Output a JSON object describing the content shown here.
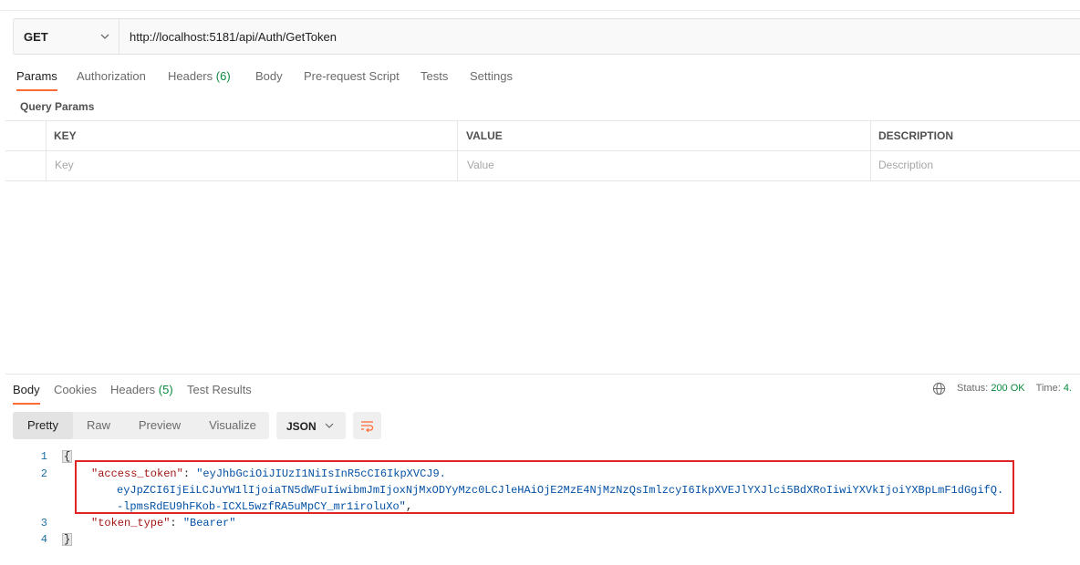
{
  "request": {
    "method": "GET",
    "url": "http://localhost:5181/api/Auth/GetToken"
  },
  "request_tabs": [
    {
      "label": "Params",
      "active": true
    },
    {
      "label": "Authorization"
    },
    {
      "label": "Headers",
      "count": "(6)"
    },
    {
      "label": "Body"
    },
    {
      "label": "Pre-request Script"
    },
    {
      "label": "Tests"
    },
    {
      "label": "Settings"
    }
  ],
  "query_params": {
    "title": "Query Params",
    "columns": [
      "KEY",
      "VALUE",
      "DESCRIPTION"
    ],
    "placeholders": [
      "Key",
      "Value",
      "Description"
    ]
  },
  "response_tabs": [
    {
      "label": "Body",
      "active": true
    },
    {
      "label": "Cookies"
    },
    {
      "label": "Headers",
      "count": "(5)"
    },
    {
      "label": "Test Results"
    }
  ],
  "response_status": {
    "status_label": "Status:",
    "status_value": "200 OK",
    "time_label": "Time:",
    "time_value": "4."
  },
  "view_modes": [
    "Pretty",
    "Raw",
    "Preview",
    "Visualize"
  ],
  "format": "JSON",
  "code": {
    "line_numbers": [
      "1",
      "2",
      "3",
      "4"
    ],
    "open_brace": "{",
    "close_brace": "}",
    "access_token_key": "\"access_token\"",
    "access_token_value_1": "\"eyJhbGciOiJIUzI1NiIsInR5cCI6IkpXVCJ9.",
    "access_token_value_2": "eyJpZCI6IjEiLCJuYW1lIjoiaTN5dWFuIiwibmJmIjoxNjMxODYyMzc0LCJleHAiOjE2MzE4NjMzNzQsImlzcyI6IkpXVEJlYXJlci5BdXRoIiwiYXVkIjoiYXBpLmF1dGgifQ.",
    "access_token_value_3": "-lpmsRdEU9hFKob-ICXL5wzfRA5uMpCY_mr1iroluXo\"",
    "token_type_key": "\"token_type\"",
    "token_type_value": "\"Bearer\""
  },
  "colors": {
    "accent": "#ff6c37",
    "status_ok": "#0a8a3d",
    "highlight_box": "#e02424",
    "json_key": "#a31515",
    "json_string": "#0451a5"
  },
  "icons": [
    "chevron-down-icon",
    "globe-icon",
    "wrap-lines-icon"
  ]
}
